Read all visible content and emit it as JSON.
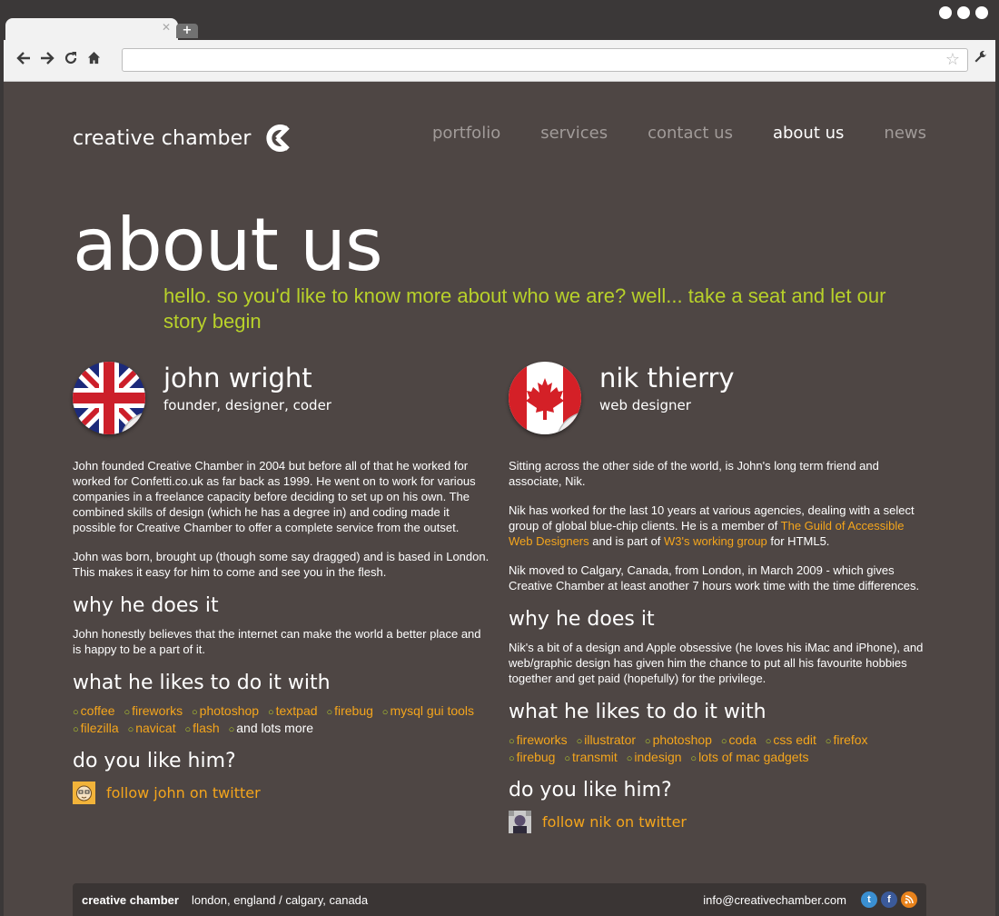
{
  "browser": {
    "tab_close": "✕",
    "new_tab": "+",
    "url": ""
  },
  "site": {
    "logo": "creative chamber",
    "nav": [
      "portfolio",
      "services",
      "contact us",
      "about us",
      "news"
    ],
    "active_nav": "about us"
  },
  "hero": {
    "title": "about us",
    "lead": "hello. so you'd like to know more about who we are? well... take a seat and let our story begin"
  },
  "john": {
    "name": "john wright",
    "role": "founder, designer, coder",
    "bio1": "John founded Creative Chamber in 2004 but before all of that he worked for worked for Confetti.co.uk as far back as 1999. He went on to work for various companies in a freelance capacity before deciding to set up on his own. The combined skills of design (which he has a degree in) and coding made it possible for Creative Chamber to offer a complete service from the outset.",
    "bio2": "John was born, brought up (though some say dragged) and is based in London. This makes it easy for him to come and see you in the flesh.",
    "why_heading": "why he does it",
    "why_text": "John honestly believes that the internet can make the world a better place and is happy to be a part of it.",
    "tools_heading": "what he likes to do it with",
    "tools": [
      "coffee",
      "fireworks",
      "photoshop",
      "textpad",
      "firebug",
      "mysql gui tools",
      "filezilla",
      "navicat",
      "flash"
    ],
    "tools_end": "and lots more",
    "like_heading": "do you like him?",
    "twitter": "follow john on twitter"
  },
  "nik": {
    "name": "nik thierry",
    "role": "web designer",
    "bio1": "Sitting across the other side of the world, is John's long term friend and associate, Nik.",
    "bio2_a": "Nik has worked for the last 10 years at various agencies, dealing with a select group of global blue-chip clients. He is a member of ",
    "bio2_link1": "The Guild of Accessible Web Designers",
    "bio2_b": " and is part of ",
    "bio2_link2": "W3's working group",
    "bio2_c": " for HTML5.",
    "bio3": "Nik moved to Calgary, Canada, from London, in March 2009 - which gives Creative Chamber at least another 7 hours work time with the time differences.",
    "why_heading": "why he does it",
    "why_text": "Nik's a bit of a design and Apple obsessive (he loves his iMac and iPhone), and web/graphic design has given him the chance to put all his favourite hobbies together and get paid (hopefully) for the privilege.",
    "tools_heading": "what he likes to do it with",
    "tools": [
      "fireworks",
      "illustrator",
      "photoshop",
      "coda",
      "css edit",
      "firefox",
      "firebug",
      "transmit",
      "indesign",
      "lots of mac gadgets"
    ],
    "like_heading": "do you like him?",
    "twitter": "follow nik on twitter"
  },
  "footer": {
    "brand": "creative chamber",
    "locations": "london, england / calgary, canada",
    "email": "info@creativechamber.com"
  },
  "colors": {
    "page_bg": "#4e4644",
    "lead_green": "#b8d12a",
    "link_orange": "#f4a51c",
    "nav_inactive": "#a19b99"
  },
  "icons": [
    "back-arrow-icon",
    "forward-arrow-icon",
    "reload-icon",
    "home-icon",
    "star-icon",
    "wrench-icon",
    "uk-flag-icon",
    "canada-flag-icon",
    "twitter-icon",
    "facebook-icon",
    "rss-icon"
  ]
}
